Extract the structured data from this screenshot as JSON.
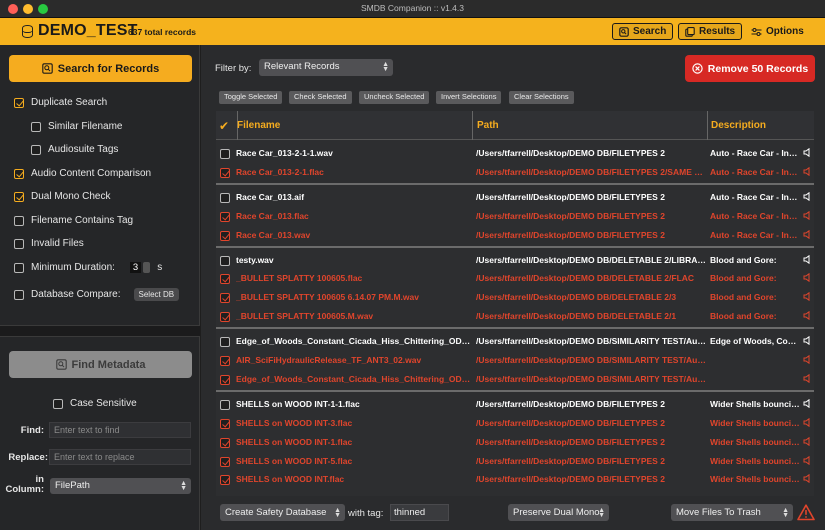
{
  "window": {
    "title": "SMDB Companion :: v1.4.3"
  },
  "header": {
    "db_name": "DEMO_TEST",
    "record_count": "637 total records",
    "buttons": {
      "search": "Search",
      "results": "Results",
      "options": "Options"
    }
  },
  "sidebar": {
    "search_button": "Search for Records",
    "options": [
      {
        "label": "Duplicate Search",
        "checked": true
      },
      {
        "label": "Similar Filename",
        "checked": false
      },
      {
        "label": "Audiosuite Tags",
        "checked": false
      },
      {
        "label": "Audio Content Comparison",
        "checked": true
      },
      {
        "label": "Dual Mono Check",
        "checked": true
      },
      {
        "label": "Filename Contains Tag",
        "checked": false
      },
      {
        "label": "Invalid Files",
        "checked": false
      },
      {
        "label": "Minimum Duration:",
        "checked": false
      },
      {
        "label": "Database Compare:",
        "checked": false
      }
    ],
    "min_duration_value": "3",
    "min_duration_unit": "s",
    "select_db_button": "Select DB",
    "find_metadata_button": "Find Metadata",
    "case_sensitive": "Case Sensitive",
    "find_label": "Find:",
    "find_placeholder": "Enter text to find",
    "replace_label": "Replace:",
    "replace_placeholder": "Enter text to replace",
    "in_column_label": "in Column:",
    "column_value": "FilePath"
  },
  "main": {
    "filter_label": "Filter by:",
    "filter_value": "Relevant Records",
    "remove_button": "Remove 50 Records",
    "actions": [
      "Toggle Selected",
      "Check Selected",
      "Uncheck Selected",
      "Invert Selections",
      "Clear Selections"
    ],
    "columns": {
      "check": "✔",
      "filename": "Filename",
      "path": "Path",
      "description": "Description"
    },
    "rows": [
      {
        "filename": "Race Car_013-2-1-1.wav",
        "path": "/Users/tfarrell/Desktop/DEMO DB/FILETYPES 2",
        "description": "Auto - Race Car - India",
        "remove": false
      },
      {
        "filename": "Race Car_013-2-1.flac",
        "path": "/Users/tfarrell/Desktop/DEMO DB/FILETYPES 2/SAME SA...",
        "description": "Auto - Race Car - India",
        "remove": true
      },
      {
        "filename": "Race Car_013.aif",
        "path": "/Users/tfarrell/Desktop/DEMO DB/FILETYPES 2",
        "description": "Auto - Race Car - India",
        "remove": false,
        "group_start": true
      },
      {
        "filename": "Race Car_013.flac",
        "path": "/Users/tfarrell/Desktop/DEMO DB/FILETYPES 2",
        "description": "Auto - Race Car - India",
        "remove": true
      },
      {
        "filename": "Race Car_013.wav",
        "path": "/Users/tfarrell/Desktop/DEMO DB/FILETYPES 2",
        "description": "Auto - Race Car - India",
        "remove": true
      },
      {
        "filename": "testy.wav",
        "path": "/Users/tfarrell/Desktop/DEMO DB/DELETABLE 2/LIBRARY",
        "description": "Blood and Gore:",
        "remove": false,
        "group_start": true
      },
      {
        "filename": "_BULLET SPLATTY 100605.flac",
        "path": "/Users/tfarrell/Desktop/DEMO DB/DELETABLE 2/FLAC",
        "description": "Blood and Gore:",
        "remove": true
      },
      {
        "filename": "_BULLET SPLATTY 100605 6.14.07 PM.M.wav",
        "path": "/Users/tfarrell/Desktop/DEMO DB/DELETABLE 2/3",
        "description": "Blood and Gore:",
        "remove": true
      },
      {
        "filename": "_BULLET SPLATTY 100605.M.wav",
        "path": "/Users/tfarrell/Desktop/DEMO DB/DELETABLE 2/1",
        "description": "Blood and Gore:",
        "remove": true
      },
      {
        "filename": "Edge_of_Woods_Constant_Cicada_Hiss_Chittering_ODY-...",
        "path": "/Users/tfarrell/Desktop/DEMO DB/SIMILARITY TEST/Audi...",
        "description": "Edge of Woods, Const",
        "remove": false,
        "group_start": true
      },
      {
        "filename": "AIR_SciFiHydraulicRelease_TF_ANT3_02.wav",
        "path": "/Users/tfarrell/Desktop/DEMO DB/SIMILARITY TEST/Audi...",
        "description": "",
        "remove": true
      },
      {
        "filename": "Edge_of_Woods_Constant_Cicada_Hiss_Chittering_ODY-...",
        "path": "/Users/tfarrell/Desktop/DEMO DB/SIMILARITY TEST/Audi...",
        "description": "",
        "remove": true
      },
      {
        "filename": "SHELLS on WOOD INT-1-1.flac",
        "path": "/Users/tfarrell/Desktop/DEMO DB/FILETYPES 2",
        "description": "Wider Shells bouncing",
        "remove": false,
        "group_start": true
      },
      {
        "filename": "SHELLS on WOOD INT-3.flac",
        "path": "/Users/tfarrell/Desktop/DEMO DB/FILETYPES 2",
        "description": "Wider Shells bouncing",
        "remove": true
      },
      {
        "filename": "SHELLS on WOOD INT-1.flac",
        "path": "/Users/tfarrell/Desktop/DEMO DB/FILETYPES 2",
        "description": "Wider Shells bouncing",
        "remove": true
      },
      {
        "filename": "SHELLS on WOOD INT-5.flac",
        "path": "/Users/tfarrell/Desktop/DEMO DB/FILETYPES 2",
        "description": "Wider Shells bouncing",
        "remove": true
      },
      {
        "filename": "SHELLS on WOOD INT.flac",
        "path": "/Users/tfarrell/Desktop/DEMO DB/FILETYPES 2",
        "description": "Wider Shells bouncing",
        "remove": true
      }
    ]
  },
  "bottom": {
    "create_safety": "Create Safety Database",
    "with_tag_label": "with tag:",
    "tag_value": "thinned",
    "dual_mono": "Preserve Dual Mono",
    "move_files": "Move Files To Trash"
  },
  "colors": {
    "accent": "#f5ac1f",
    "danger": "#d72924",
    "remove_text": "#e0452c",
    "keep_text": "#ffffff"
  }
}
